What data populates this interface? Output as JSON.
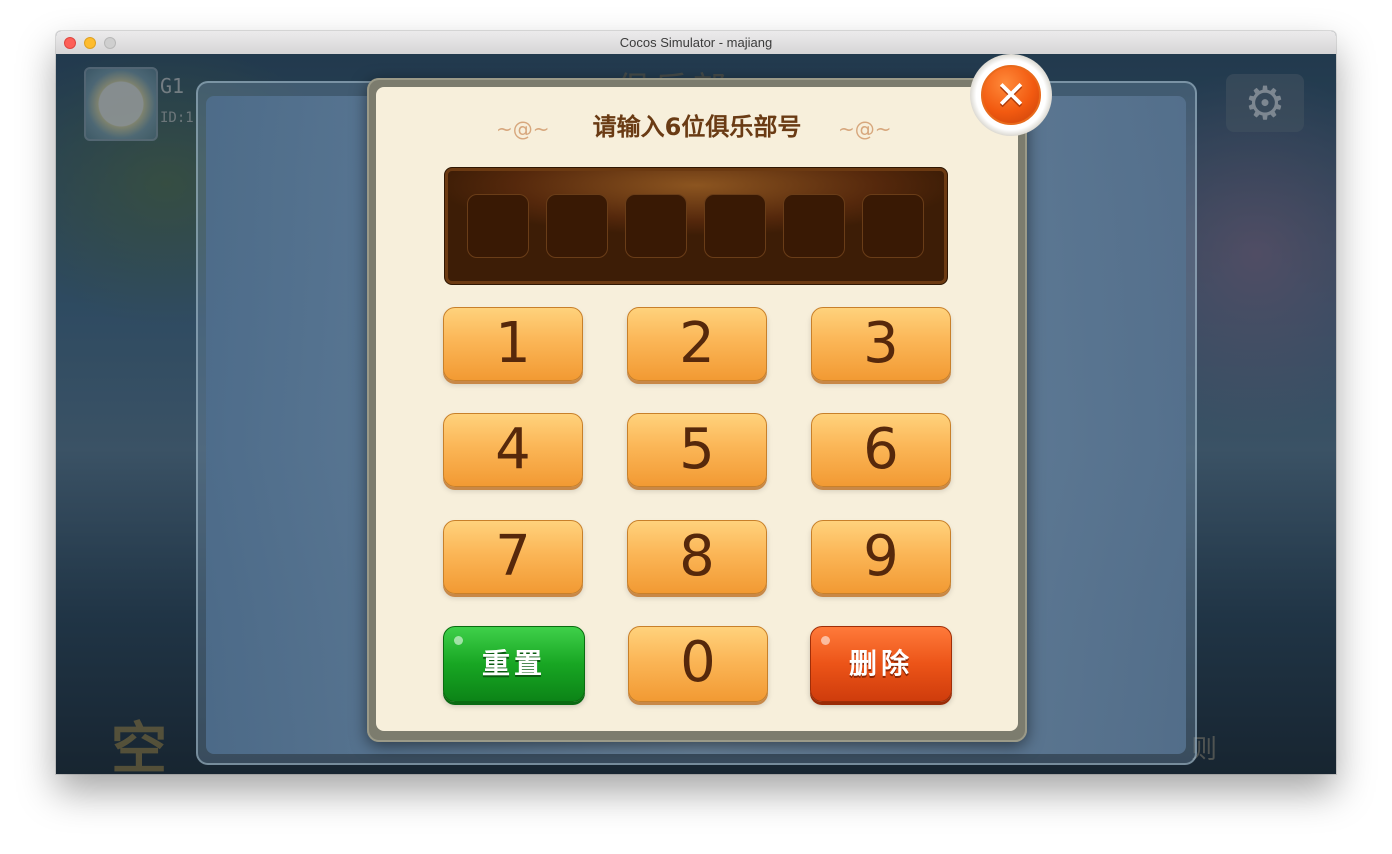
{
  "window": {
    "title": "Cocos Simulator - majiang"
  },
  "background": {
    "player_name": "G1",
    "player_id": "ID:1",
    "partial_title": "俱乐部",
    "partial_sign": "空",
    "partial_rule": "则",
    "settings_icon": "gear-icon",
    "avatar_icon": "flower-avatar"
  },
  "dialog": {
    "title": "请输入6位俱乐部号",
    "ornament_left": "~@~",
    "ornament_right": "~@~",
    "close_icon": "close-icon",
    "close_glyph": "✕",
    "code_slots": [
      "",
      "",
      "",
      "",
      "",
      ""
    ],
    "keys": {
      "k1": "1",
      "k2": "2",
      "k3": "3",
      "k4": "4",
      "k5": "5",
      "k6": "6",
      "k7": "7",
      "k8": "8",
      "k9": "9",
      "k0": "0",
      "reset": "重置",
      "delete": "删除"
    },
    "colors": {
      "key_orange": "#fbb657",
      "reset_green": "#18a623",
      "delete_red": "#ec5418",
      "panel_cream": "#f7efdb",
      "title_brown": "#6a3b14"
    }
  }
}
